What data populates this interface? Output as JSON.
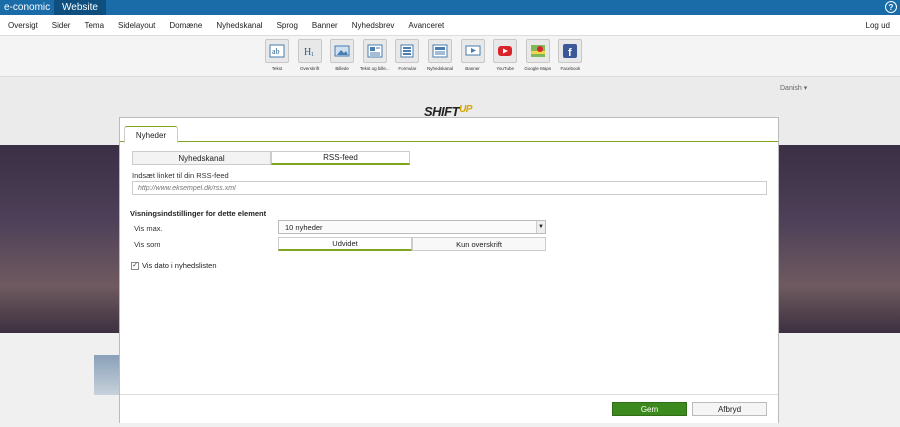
{
  "topbar": {
    "brand": "e-conomic",
    "active_tab": "Website",
    "help_icon": "?"
  },
  "menu": {
    "items": [
      "Oversigt",
      "Sider",
      "Tema",
      "Sidelayout",
      "Domæne",
      "Nyhedskanal",
      "Sprog",
      "Banner",
      "Nyhedsbrev",
      "Avanceret"
    ],
    "logout": "Log ud"
  },
  "toolbar": {
    "tools": [
      {
        "label": "Tekst",
        "icon": "text-icon"
      },
      {
        "label": "Overskrift",
        "icon": "heading-icon"
      },
      {
        "label": "Billede",
        "icon": "image-icon"
      },
      {
        "label": "Tekst og bille...",
        "icon": "text-image-icon"
      },
      {
        "label": "Formular",
        "icon": "form-icon"
      },
      {
        "label": "Nyhedskanal",
        "icon": "news-icon"
      },
      {
        "label": "Banner",
        "icon": "banner-icon"
      },
      {
        "label": "YouTube",
        "icon": "youtube-icon"
      },
      {
        "label": "Google Maps",
        "icon": "maps-icon"
      },
      {
        "label": "Facebook",
        "icon": "facebook-icon"
      }
    ]
  },
  "site": {
    "language": "Danish",
    "logo_main": "SHIFT",
    "logo_accent": "UP"
  },
  "modal": {
    "tab": "Nyheder",
    "source_options": [
      "Nyhedskanal",
      "RSS-feed"
    ],
    "source_selected": "RSS-feed",
    "url_label": "Indsæt linket til din RSS-feed",
    "url_placeholder": "http://www.eksempel.dk/rss.xml",
    "url_value": "",
    "display_heading": "Visningsindstillinger for dette element",
    "vis_max_label": "Vis max.",
    "vis_max_value": "10 nyheder",
    "vis_som_label": "Vis som",
    "vis_som_options": [
      "Udvidet",
      "Kun overskrift"
    ],
    "vis_som_selected": "Udvidet",
    "show_date_label": "Vis dato i nyhedslisten",
    "show_date_checked": true,
    "save": "Gem",
    "cancel": "Afbryd"
  },
  "colors": {
    "topbar": "#1a6ca8",
    "accent_green": "#7ea51d",
    "save_button": "#3c8a1e"
  }
}
